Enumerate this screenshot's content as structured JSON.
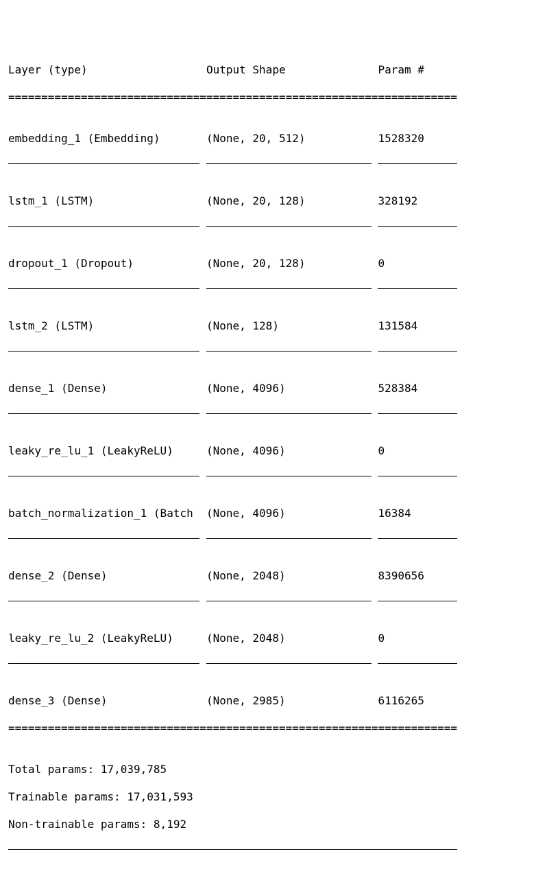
{
  "chart_data": {
    "type": "table",
    "columns": [
      "Layer (type)",
      "Output Shape",
      "Param #"
    ],
    "rows": [
      [
        "embedding_1 (Embedding)",
        "(None, 20, 512)",
        "1528320"
      ],
      [
        "lstm_1 (LSTM)",
        "(None, 20, 128)",
        "328192"
      ],
      [
        "dropout_1 (Dropout)",
        "(None, 20, 128)",
        "0"
      ],
      [
        "lstm_2 (LSTM)",
        "(None, 128)",
        "131584"
      ],
      [
        "dense_1 (Dense)",
        "(None, 4096)",
        "528384"
      ],
      [
        "leaky_re_lu_1 (LeakyReLU)",
        "(None, 4096)",
        "0"
      ],
      [
        "batch_normalization_1 (Batch",
        "(None, 4096)",
        "16384"
      ],
      [
        "dense_2 (Dense)",
        "(None, 2048)",
        "8390656"
      ],
      [
        "leaky_re_lu_2 (LeakyReLU)",
        "(None, 2048)",
        "0"
      ],
      [
        "dense_3 (Dense)",
        "(None, 2985)",
        "6116265"
      ]
    ],
    "summary": {
      "total_params": "17,039,785",
      "trainable_params": "17,031,593",
      "non_trainable_params": "8,192"
    }
  },
  "header": {
    "layer": "Layer (type)",
    "shape": "Output Shape",
    "param": "Param #"
  },
  "divider": "====================================================================",
  "rows": {
    "0": {
      "layer": "embedding_1 (Embedding)",
      "shape": "(None, 20, 512)",
      "param": "1528320"
    },
    "1": {
      "layer": "lstm_1 (LSTM)",
      "shape": "(None, 20, 128)",
      "param": "328192"
    },
    "2": {
      "layer": "dropout_1 (Dropout)",
      "shape": "(None, 20, 128)",
      "param": "0"
    },
    "3": {
      "layer": "lstm_2 (LSTM)",
      "shape": "(None, 128)",
      "param": "131584"
    },
    "4": {
      "layer": "dense_1 (Dense)",
      "shape": "(None, 4096)",
      "param": "528384"
    },
    "5": {
      "layer": "leaky_re_lu_1 (LeakyReLU)",
      "shape": "(None, 4096)",
      "param": "0"
    },
    "6": {
      "layer": "batch_normalization_1 (Batch",
      "shape": "(None, 4096)",
      "param": "16384"
    },
    "7": {
      "layer": "dense_2 (Dense)",
      "shape": "(None, 2048)",
      "param": "8390656"
    },
    "8": {
      "layer": "leaky_re_lu_2 (LeakyReLU)",
      "shape": "(None, 2048)",
      "param": "0"
    },
    "9": {
      "layer": "dense_3 (Dense)",
      "shape": "(None, 2985)",
      "param": "6116265"
    }
  },
  "summary": {
    "total": "Total params: 17,039,785",
    "trainable": "Trainable params: 17,031,593",
    "non_trainable": "Non-trainable params: 8,192"
  }
}
